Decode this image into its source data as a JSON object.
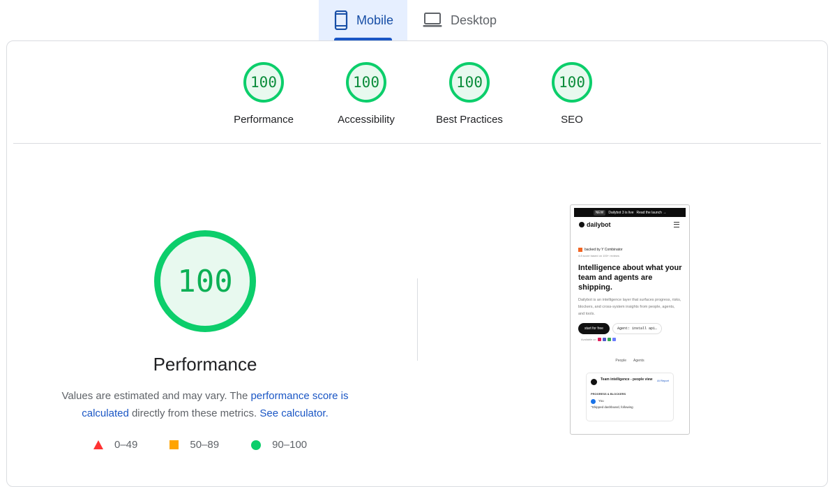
{
  "tabs": [
    {
      "label": "Mobile",
      "icon": "smartphone-icon",
      "active": true
    },
    {
      "label": "Desktop",
      "icon": "laptop-icon",
      "active": false
    }
  ],
  "gauges": [
    {
      "score": "100",
      "label": "Performance"
    },
    {
      "score": "100",
      "label": "Accessibility"
    },
    {
      "score": "100",
      "label": "Best Practices"
    },
    {
      "score": "100",
      "label": "SEO"
    }
  ],
  "performance": {
    "score": "100",
    "title": "Performance",
    "desc_prefix": "Values are estimated and may vary. The ",
    "desc_link1": "performance score is calculated",
    "desc_middle": " directly from these metrics. ",
    "desc_link2": "See calculator."
  },
  "legend": [
    {
      "shape": "triangle",
      "color": "#ff3333",
      "range": "0–49"
    },
    {
      "shape": "square",
      "color": "#ffa400",
      "range": "50–89"
    },
    {
      "shape": "circle",
      "color": "#0cce6b",
      "range": "90–100"
    }
  ],
  "screenshot": {
    "announce_badge": "NEW",
    "announce_text": "Dailybot 3 is live",
    "announce_link": "Read the launch →",
    "brand": "dailybot",
    "backed": "backed by Y Combinator",
    "rating": "4.8 score based on 100+ reviews",
    "headline": "Intelligence about what your team and agents are shipping.",
    "subtext": "Dailybot is an intelligence layer that surfaces progress, risks, blockers, and cross-system insights from people, agents, and tools.",
    "cta_button": "start for free",
    "agent_cmd": "Agent: install api…",
    "available_on": "Available on",
    "toggle_people": "People",
    "toggle_agents": "Agents",
    "panel_title": "Team intelligence - people view",
    "panel_right": "AI Report",
    "panel_section": "PROGRESS & BLOCKERS",
    "panel_user": "You",
    "panel_quote": "\"Shipped dashboard, following"
  },
  "colors": {
    "accent": "#1a56c5",
    "pass": "#0cce6b",
    "tab_active_bg": "#e6efff"
  }
}
